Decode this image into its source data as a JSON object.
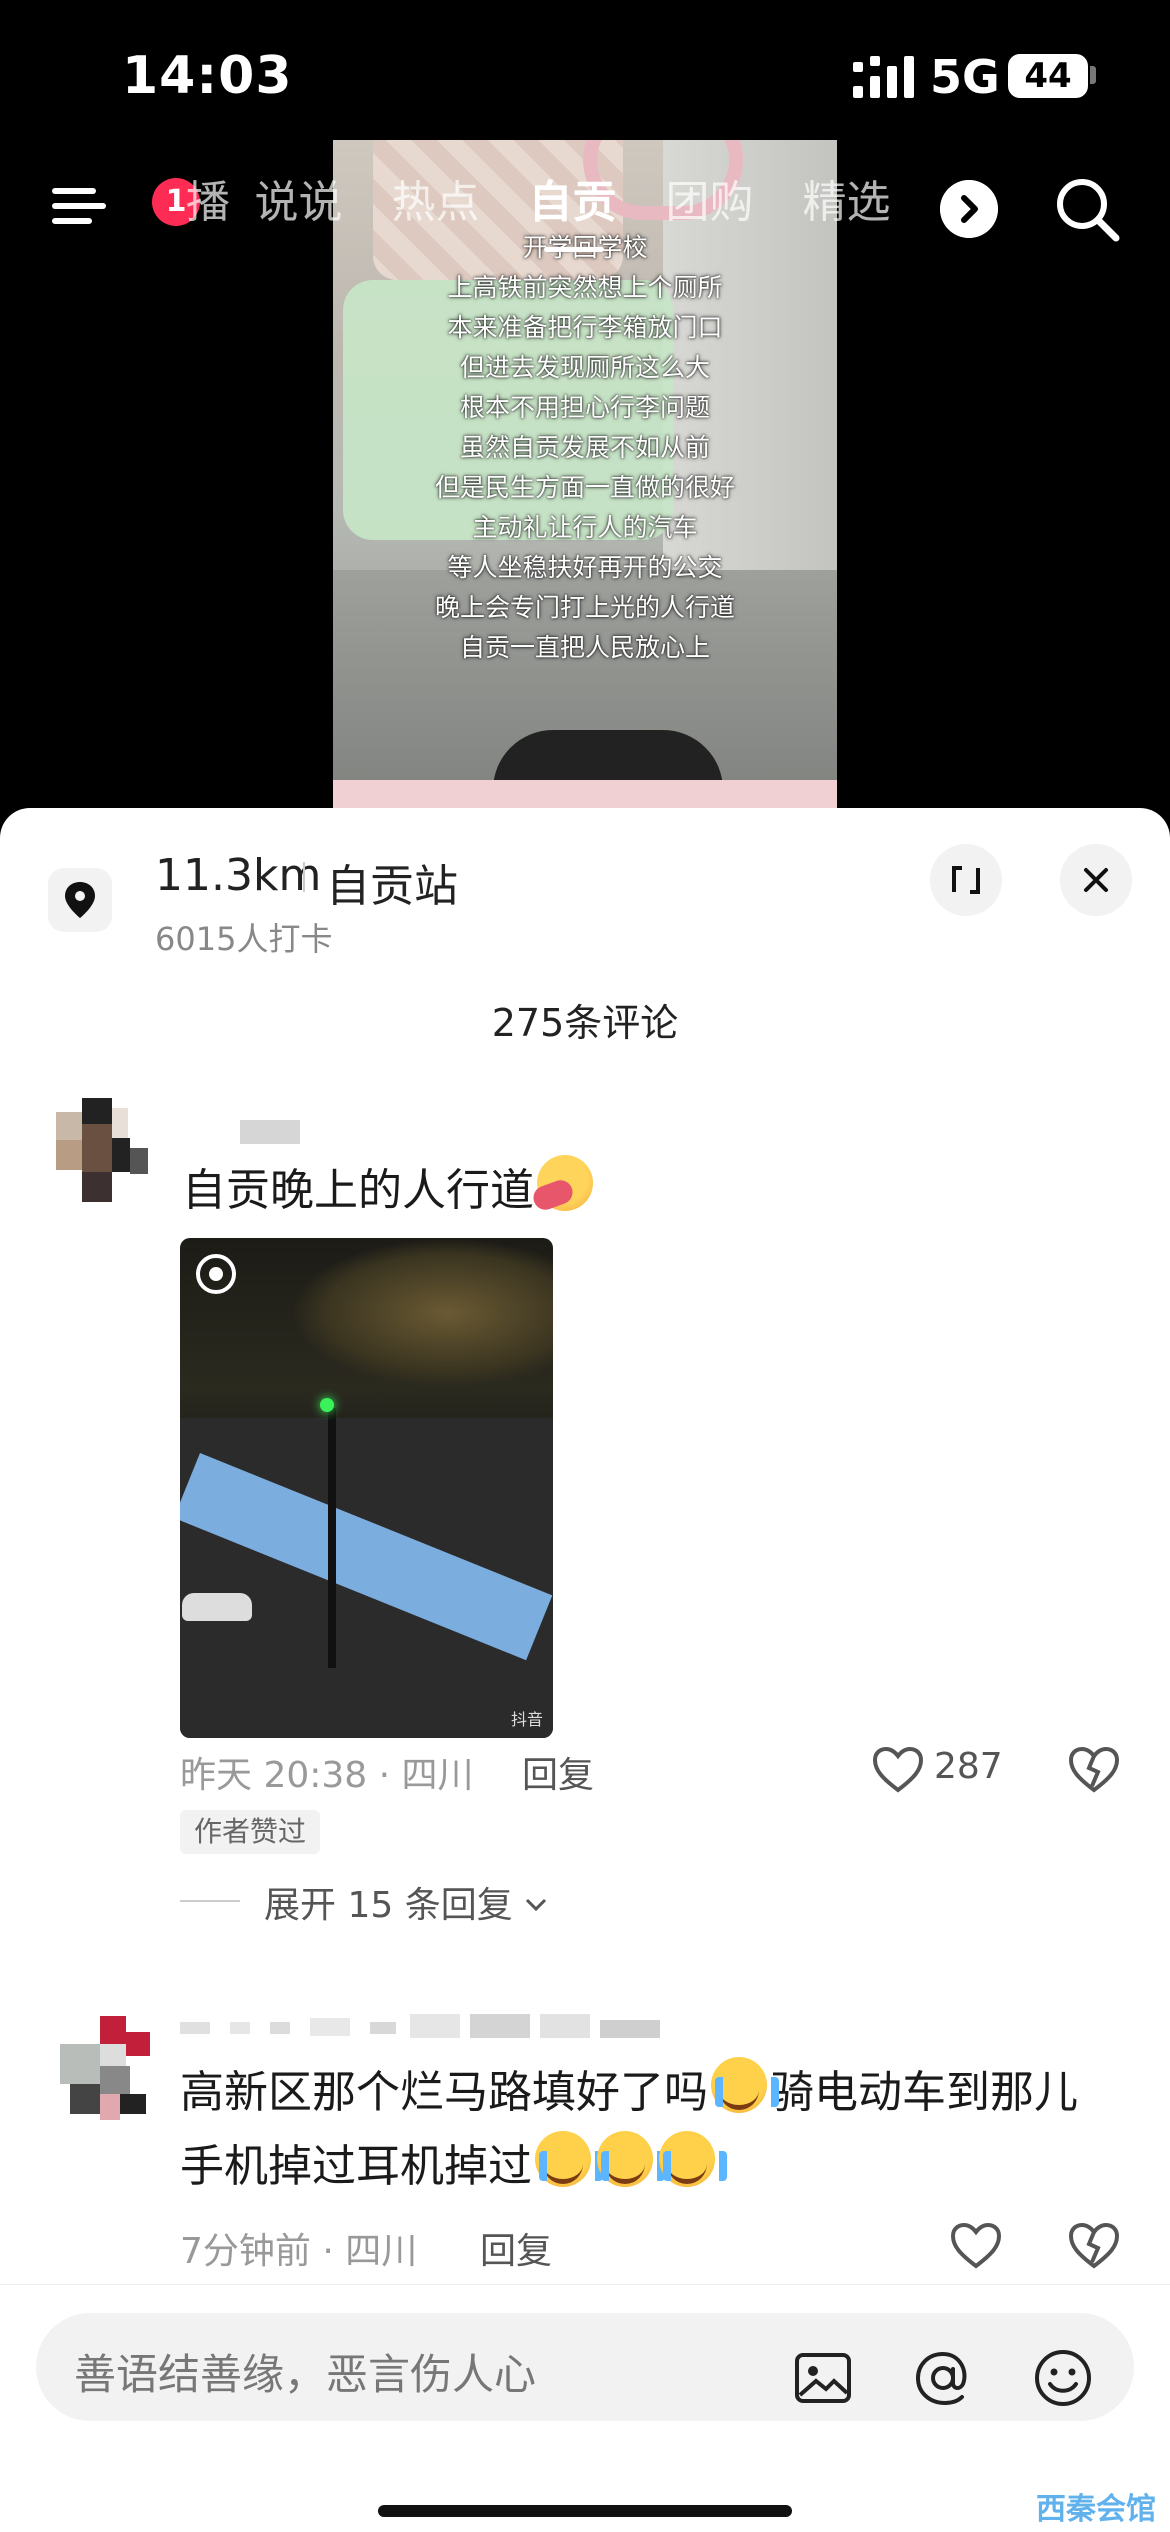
{
  "status": {
    "time": "14:03",
    "network": "5G",
    "battery": "44"
  },
  "nav": {
    "badge": "1",
    "tabs": [
      "播",
      "说说",
      "热点",
      "自贡",
      "团购",
      "精选"
    ],
    "active_index": 3
  },
  "video": {
    "caption_lines": [
      "开学回学校",
      "上高铁前突然想上个厕所",
      "本来准备把行李箱放门口",
      "但进去发现厕所这么大",
      "根本不用担心行李问题",
      "虽然自贡发展不如从前",
      "但是民生方面一直做的很好",
      "主动礼让行人的汽车",
      "等人坐稳扶好再开的公交",
      "晚上会专门打上光的人行道",
      "自贡一直把人民放心上"
    ]
  },
  "sheet": {
    "distance": "11.3km",
    "station": "自贡站",
    "checkins": "6015人打卡",
    "comment_count": "275条评论"
  },
  "comments": [
    {
      "text": "自贡晚上的人行道",
      "emoji": "hug-emoji",
      "image_watermark": "抖音",
      "meta": "昨天 20:38 · 四川",
      "reply_label": "回复",
      "likes": "287",
      "author_tag": "作者赞过",
      "expand_label": "展开 15 条回复"
    },
    {
      "text_line1": "高新区那个烂马路填好了吗",
      "text_line1b": "骑电动车到那儿",
      "text_line2": "手机掉过耳机掉过",
      "emoji": "cry-emoji",
      "meta": "7分钟前 · 四川",
      "reply_label": "回复"
    }
  ],
  "input": {
    "placeholder": "善语结善缘，恶言伤人心"
  },
  "watermark": "西秦会馆",
  "colors": {
    "badge": "#fe2c55",
    "accent": "#3aa0e8"
  }
}
